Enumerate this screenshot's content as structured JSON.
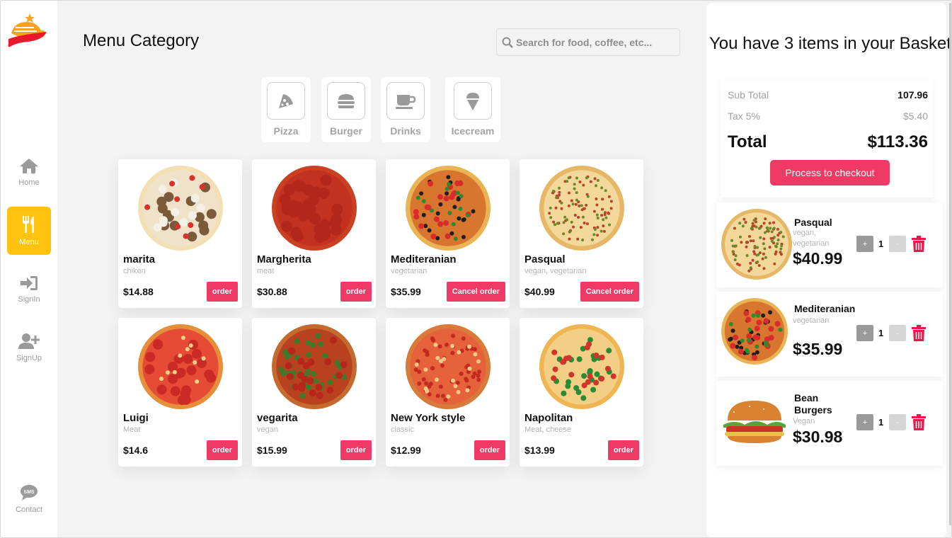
{
  "sidebar": {
    "items": [
      {
        "label": "Home",
        "icon": "home-icon"
      },
      {
        "label": "Menu",
        "icon": "fork-knife-icon",
        "active": true
      },
      {
        "label": "SignIn",
        "icon": "sign-in-icon"
      },
      {
        "label": "SignUp",
        "icon": "add-user-icon"
      }
    ],
    "contact": {
      "label": "Contact",
      "icon": "sms-icon",
      "badge": "SMS"
    }
  },
  "header": {
    "title": "Menu Category",
    "search_placeholder": "Search for food, coffee, etc..."
  },
  "categories": [
    {
      "label": "Pizza",
      "icon": "pizza-icon"
    },
    {
      "label": "Burger",
      "icon": "burger-icon"
    },
    {
      "label": "Drinks",
      "icon": "coffee-cup-icon"
    },
    {
      "label": "Icecream",
      "icon": "icecream-icon"
    }
  ],
  "products": [
    {
      "name": "marita",
      "tag": "chiken",
      "price": "$14.88",
      "button": "order"
    },
    {
      "name": "Margherita",
      "tag": "meat",
      "price": "$30.88",
      "button": "order"
    },
    {
      "name": "Mediteranian",
      "tag": "vegetarian",
      "price": "$35.99",
      "button": "Cancel order"
    },
    {
      "name": "Pasqual",
      "tag": "vegan, vegetarian",
      "price": "$40.99",
      "button": "Cancel order"
    },
    {
      "name": "Luigi",
      "tag": "Meat",
      "price": "$14.6",
      "button": "order"
    },
    {
      "name": "vegarita",
      "tag": "vegan",
      "price": "$15.99",
      "button": "order"
    },
    {
      "name": "New York style",
      "tag": "classic",
      "price": "$12.99",
      "button": "order"
    },
    {
      "name": "Napolitan",
      "tag": "Meat, cheese",
      "price": "$13.99",
      "button": "order"
    }
  ],
  "basket": {
    "title": "You have 3 items in your Basket",
    "subtotal_label": "Sub Total",
    "subtotal_value": "107.96",
    "tax_label": "Tax 5%",
    "tax_value": "$5.40",
    "total_label": "Total",
    "total_value": "$113.36",
    "checkout_label": "Process to checkout",
    "plus_label": "+",
    "minus_label": "-",
    "items": [
      {
        "name": "Pasqual",
        "tag": "vegan, vegetarian",
        "price": "$40.99",
        "qty": "1"
      },
      {
        "name": "Mediteranian",
        "tag": "vegetarian",
        "price": "$35.99",
        "qty": "1"
      },
      {
        "name": "Bean Burgers",
        "tag": "Vegan",
        "price": "$30.98",
        "qty": "1"
      }
    ]
  },
  "colors": {
    "accent": "#f03a66",
    "active_nav": "#ffc20e",
    "background": "#f3f3f3"
  }
}
